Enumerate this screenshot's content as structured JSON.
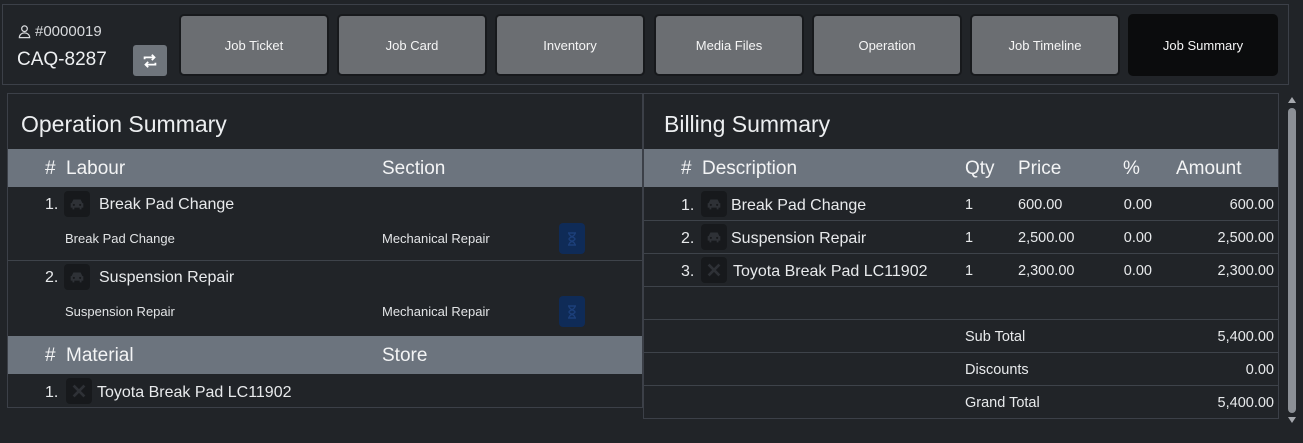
{
  "header": {
    "job_number": "#0000019",
    "plate": "CAQ-8287",
    "tabs": [
      {
        "label": "Job Ticket",
        "active": false
      },
      {
        "label": "Job Card",
        "active": false
      },
      {
        "label": "Inventory",
        "active": false
      },
      {
        "label": "Media Files",
        "active": false
      },
      {
        "label": "Operation",
        "active": false
      },
      {
        "label": "Job  Timeline",
        "active": false
      },
      {
        "label": "Job Summary",
        "active": true
      }
    ]
  },
  "operation_summary": {
    "title": "Operation Summary",
    "labour_header": {
      "hash": "#",
      "labour": "Labour",
      "section": "Section"
    },
    "labour": [
      {
        "index": "1.",
        "name": "Break Pad Change",
        "detail": "Break Pad Change",
        "section": "Mechanical Repair",
        "icon": "car-icon",
        "status_icon": "hourglass-icon"
      },
      {
        "index": "2.",
        "name": "Suspension Repair",
        "detail": "Suspension Repair",
        "section": "Mechanical Repair",
        "icon": "car-icon",
        "status_icon": "hourglass-icon"
      }
    ],
    "material_header": {
      "hash": "#",
      "material": "Material",
      "store": "Store"
    },
    "materials": [
      {
        "index": "1.",
        "name": "Toyota Break Pad LC11902",
        "store": "",
        "icon": "tools-icon"
      }
    ]
  },
  "billing_summary": {
    "title": "Billing Summary",
    "header": {
      "hash": "#",
      "description": "Description",
      "qty": "Qty",
      "price": "Price",
      "percent": "%",
      "amount": "Amount"
    },
    "items": [
      {
        "index": "1.",
        "description": "Break Pad Change",
        "qty": "1",
        "price": "600.00",
        "percent": "0.00",
        "amount": "600.00",
        "icon": "car-icon"
      },
      {
        "index": "2.",
        "description": "Suspension Repair",
        "qty": "1",
        "price": "2,500.00",
        "percent": "0.00",
        "amount": "2,500.00",
        "icon": "car-icon"
      },
      {
        "index": "3.",
        "description": "Toyota Break Pad LC11902",
        "qty": "1",
        "price": "2,300.00",
        "percent": "0.00",
        "amount": "2,300.00",
        "icon": "tools-icon"
      }
    ],
    "totals": [
      {
        "label": "Sub Total",
        "value": "5,400.00"
      },
      {
        "label": "Discounts",
        "value": "0.00"
      },
      {
        "label": "Grand Total",
        "value": "5,400.00"
      }
    ]
  },
  "colors": {
    "background": "#212428",
    "table_header": "#6c747e",
    "tab": "#6b6e72",
    "tab_active": "#0b0c0d",
    "status_button": "#0f2b57"
  }
}
